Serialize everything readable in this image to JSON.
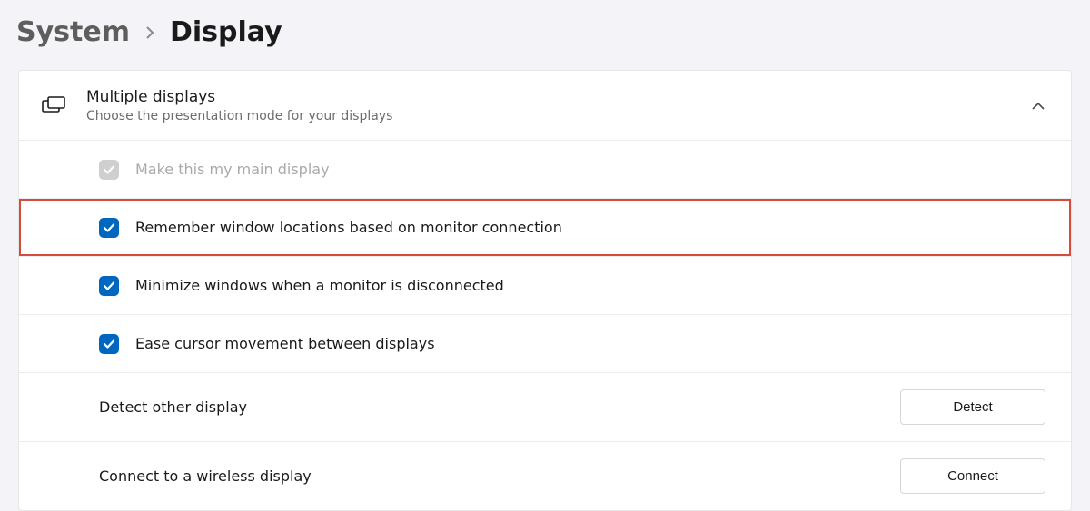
{
  "breadcrumb": {
    "parent": "System",
    "current": "Display"
  },
  "section": {
    "title": "Multiple displays",
    "subtitle": "Choose the presentation mode for your displays"
  },
  "options": {
    "main_display": {
      "label": "Make this my main display",
      "checked": false,
      "disabled": true
    },
    "remember_locations": {
      "label": "Remember window locations based on monitor connection",
      "checked": true
    },
    "minimize_disconnect": {
      "label": "Minimize windows when a monitor is disconnected",
      "checked": true
    },
    "ease_cursor": {
      "label": "Ease cursor movement between displays",
      "checked": true
    }
  },
  "actions": {
    "detect": {
      "label": "Detect other display",
      "button": "Detect"
    },
    "wireless": {
      "label": "Connect to a wireless display",
      "button": "Connect"
    }
  },
  "colors": {
    "accent": "#0067c0",
    "highlight_border": "#d64b3e"
  }
}
